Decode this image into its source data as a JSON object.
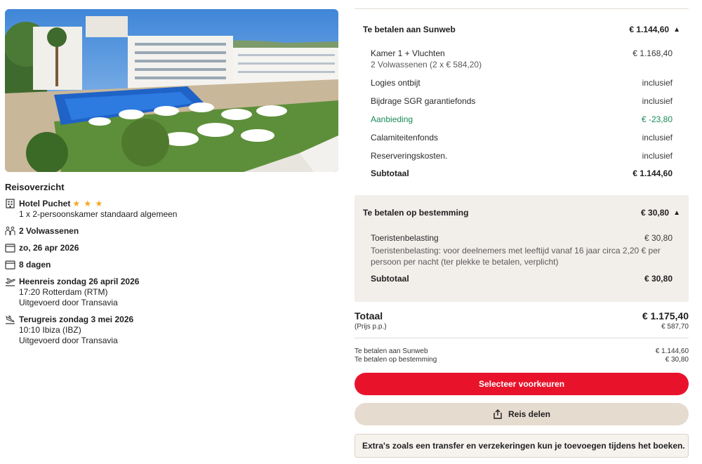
{
  "overview": {
    "title": "Reisoverzicht",
    "hotel": {
      "name": "Hotel Puchet",
      "stars": 3,
      "stars_display": "★ ★ ★",
      "room": "1 x 2-persoonskamer standaard algemeen"
    },
    "travelers": "2 Volwassenen",
    "date": "zo, 26 apr 2026",
    "duration": "8 dagen",
    "outbound": {
      "title": "Heenreis zondag 26 april 2026",
      "time_place": "17:20 Rotterdam (RTM)",
      "carrier": "Uitgevoerd door Transavia"
    },
    "return": {
      "title": "Terugreis zondag 3 mei 2026",
      "time_place": "10:10 Ibiza (IBZ)",
      "carrier": "Uitgevoerd door Transavia"
    }
  },
  "sunweb": {
    "title": "Te betalen aan Sunweb",
    "amount": "€ 1.144,60",
    "items": [
      {
        "label": "Kamer 1 + Vluchten",
        "value": "€ 1.168,40",
        "sub": "2 Volwassenen (2 x € 584,20)"
      },
      {
        "label": "Logies ontbijt",
        "value": "inclusief"
      },
      {
        "label": "Bijdrage SGR garantiefonds",
        "value": "inclusief"
      },
      {
        "label": "Aanbieding",
        "value": "€ -23,80"
      },
      {
        "label": "Calamiteitenfonds",
        "value": "inclusief"
      },
      {
        "label": "Reserveringskosten.",
        "value": "inclusief"
      }
    ],
    "subtotal_label": "Subtotaal",
    "subtotal_value": "€ 1.144,60"
  },
  "destination": {
    "title": "Te betalen op bestemming",
    "amount": "€ 30,80",
    "item_label": "Toeristenbelasting",
    "item_value": "€ 30,80",
    "item_note": "Toeristenbelasting: voor deelnemers met leeftijd vanaf 16 jaar circa 2,20 € per persoon per nacht (ter plekke te betalen, verplicht)",
    "subtotal_label": "Subtotaal",
    "subtotal_value": "€ 30,80"
  },
  "total": {
    "label": "Totaal",
    "amount": "€ 1.175,40",
    "pp_label": "(Prijs p.p.)",
    "pp_amount": "€ 587,70",
    "split": [
      {
        "label": "Te betalen aan Sunweb",
        "value": "€ 1.144,60"
      },
      {
        "label": "Te betalen op bestemming",
        "value": "€ 30,80"
      }
    ]
  },
  "actions": {
    "primary": "Selecteer voorkeuren",
    "share": "Reis delen"
  },
  "info": "Extra's zoals een transfer en verzekeringen kun je toevoegen tijdens het boeken.",
  "colors": {
    "brand_red": "#e8132b",
    "sand": "#e6dbcf",
    "green": "#1a8a5a",
    "star": "#f5a623"
  }
}
